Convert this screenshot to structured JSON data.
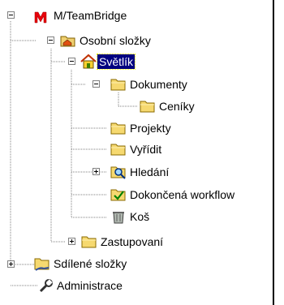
{
  "tree": {
    "root": {
      "label": "M/TeamBridge",
      "icon": "teambridge-logo-icon"
    },
    "osobni": {
      "label": "Osobní složky",
      "icon": "home-folder-icon"
    },
    "svetlik": {
      "label": "Světlík",
      "icon": "house-icon",
      "selected": true
    },
    "dokumenty": {
      "label": "Dokumenty",
      "icon": "folder-icon"
    },
    "ceniky": {
      "label": "Ceníky",
      "icon": "folder-icon"
    },
    "projekty": {
      "label": "Projekty",
      "icon": "folder-icon"
    },
    "vyridit": {
      "label": "Vyřídit",
      "icon": "folder-icon"
    },
    "hledani": {
      "label": "Hledání",
      "icon": "search-folder-icon"
    },
    "dokoncena": {
      "label": "Dokončená workflow",
      "icon": "completed-folder-icon"
    },
    "kos": {
      "label": "Koš",
      "icon": "trash-icon"
    },
    "zastupovani": {
      "label": "Zastupovaní",
      "icon": "folder-icon"
    },
    "sdilene": {
      "label": "Sdílené složky",
      "icon": "shared-folder-icon"
    },
    "administrace": {
      "label": "Administrace",
      "icon": "wrench-icon"
    }
  }
}
